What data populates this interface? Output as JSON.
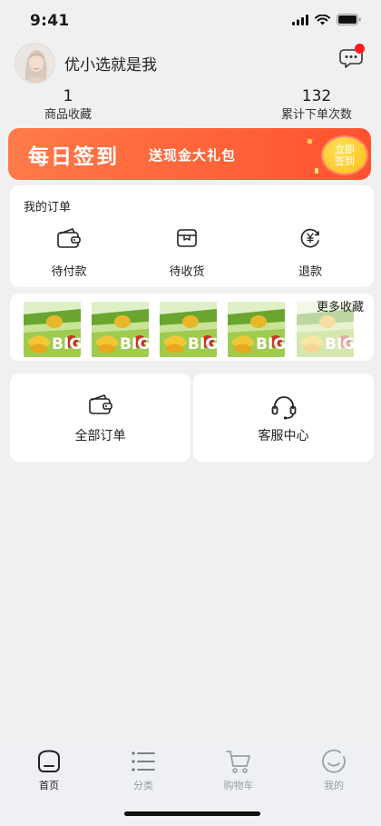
{
  "status_bar": {
    "time": "9:41",
    "icons": [
      "signal-icon",
      "wifi-icon",
      "battery-icon"
    ]
  },
  "profile": {
    "username": "优小选就是我",
    "avatar": "avatar-photo",
    "message_icon": "chat-bubble-icon",
    "has_unread": true
  },
  "stats": {
    "favorites": {
      "value": "1",
      "label": "商品收藏"
    },
    "orders": {
      "value": "132",
      "label": "累计下单次数"
    }
  },
  "signin": {
    "title": "每日签到",
    "subtitle": "送现金大礼包",
    "button_line1": "立即",
    "button_line2": "签到",
    "colors": {
      "start": "#ff7a4a",
      "end": "#ff5230",
      "button": "#ffbd14"
    }
  },
  "orders": {
    "title": "我的订单",
    "items": [
      {
        "label": "待付款",
        "icon": "wallet-icon"
      },
      {
        "label": "待收货",
        "icon": "package-box-icon"
      },
      {
        "label": "退款",
        "icon": "refund-yuan-icon"
      }
    ]
  },
  "favorites": {
    "more_label": "更多收藏",
    "thumbnail_text": "BIG",
    "count_visible": 5
  },
  "shortcuts": [
    {
      "label": "全部订单",
      "icon": "wallet-icon"
    },
    {
      "label": "客服中心",
      "icon": "headset-icon"
    }
  ],
  "tab_bar": {
    "active": "home",
    "tabs": [
      {
        "key": "home",
        "label": "首页",
        "icon": "home-icon"
      },
      {
        "key": "category",
        "label": "分类",
        "icon": "list-icon"
      },
      {
        "key": "cart",
        "label": "购物车",
        "icon": "cart-icon"
      },
      {
        "key": "mine",
        "label": "我的",
        "icon": "smiley-icon"
      }
    ]
  }
}
